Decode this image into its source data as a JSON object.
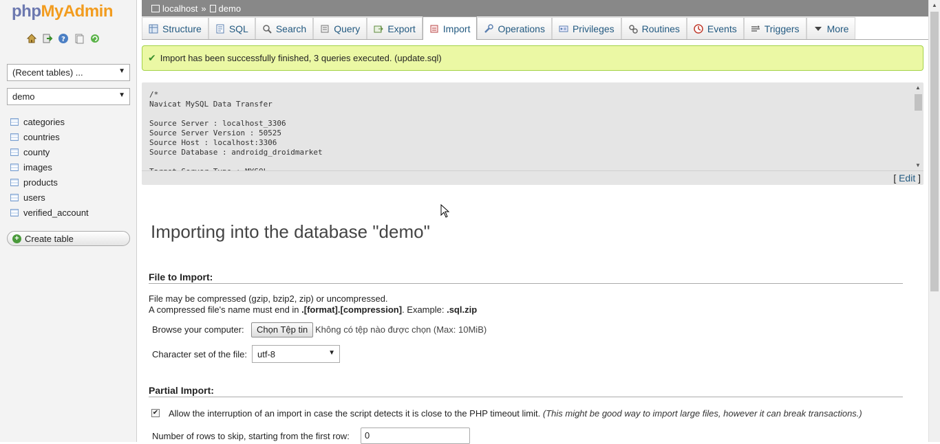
{
  "logo": {
    "part1": "php",
    "part2": "MyAdmin"
  },
  "nav": {
    "icons": [
      "home-icon",
      "logout-icon",
      "help-icon",
      "docs-icon",
      "reload-icon"
    ],
    "recent_select": "(Recent tables) ...",
    "db_select": "demo",
    "tables": [
      "categories",
      "countries",
      "county",
      "images",
      "products",
      "users",
      "verified_account"
    ],
    "create_table": "Create table"
  },
  "breadcrumb": {
    "server": "localhost",
    "separator": "»",
    "database": "demo"
  },
  "tabs": [
    {
      "label": "Structure",
      "icon": "structure-icon"
    },
    {
      "label": "SQL",
      "icon": "sql-icon"
    },
    {
      "label": "Search",
      "icon": "search-icon"
    },
    {
      "label": "Query",
      "icon": "query-icon"
    },
    {
      "label": "Export",
      "icon": "export-icon"
    },
    {
      "label": "Import",
      "icon": "import-icon"
    },
    {
      "label": "Operations",
      "icon": "operations-icon"
    },
    {
      "label": "Privileges",
      "icon": "privileges-icon"
    },
    {
      "label": "Routines",
      "icon": "routines-icon"
    },
    {
      "label": "Events",
      "icon": "events-icon"
    },
    {
      "label": "Triggers",
      "icon": "triggers-icon"
    },
    {
      "label": "More",
      "icon": "more-icon"
    }
  ],
  "active_tab": "Import",
  "notice": "Import has been successfully finished, 3 queries executed. (update.sql)",
  "sql_preview": "/*\nNavicat MySQL Data Transfer\n\nSource Server : localhost_3306\nSource Server Version : 50525\nSource Host : localhost:3306\nSource Database : androidg_droidmarket\n\nTarget Server Type : MYSQL",
  "edit": {
    "open": "[",
    "label": "Edit",
    "close": "]"
  },
  "import": {
    "title": "Importing into the database \"demo\"",
    "file_section": "File to Import:",
    "compress_note": "File may be compressed (gzip, bzip2, zip) or uncompressed.",
    "name_note_prefix": "A compressed file's name must end in ",
    "name_note_format": ".[format].[compression]",
    "name_note_example": ". Example: ",
    "name_note_ext": ".sql.zip",
    "browse_label": "Browse your computer:",
    "choose_button": "Chọn Tệp tin",
    "file_status": "Không có tệp nào được chọn (Max: 10MiB)",
    "charset_label": "Character set of the file:",
    "charset_value": "utf-8",
    "partial_section": "Partial Import:",
    "allow_label": "Allow the interruption of an import in case the script detects it is close to the PHP timeout limit.",
    "allow_note": "(This might be good way to import large files, however it can break transactions.)",
    "allow_checked": true,
    "skip_label": "Number of rows to skip, starting from the first row:",
    "skip_value": "0"
  },
  "colors": {
    "accent": "#235a81",
    "notice_bg": "#ebf8a4",
    "notice_border": "#a2d246",
    "breadcrumb_bg": "#888888"
  }
}
